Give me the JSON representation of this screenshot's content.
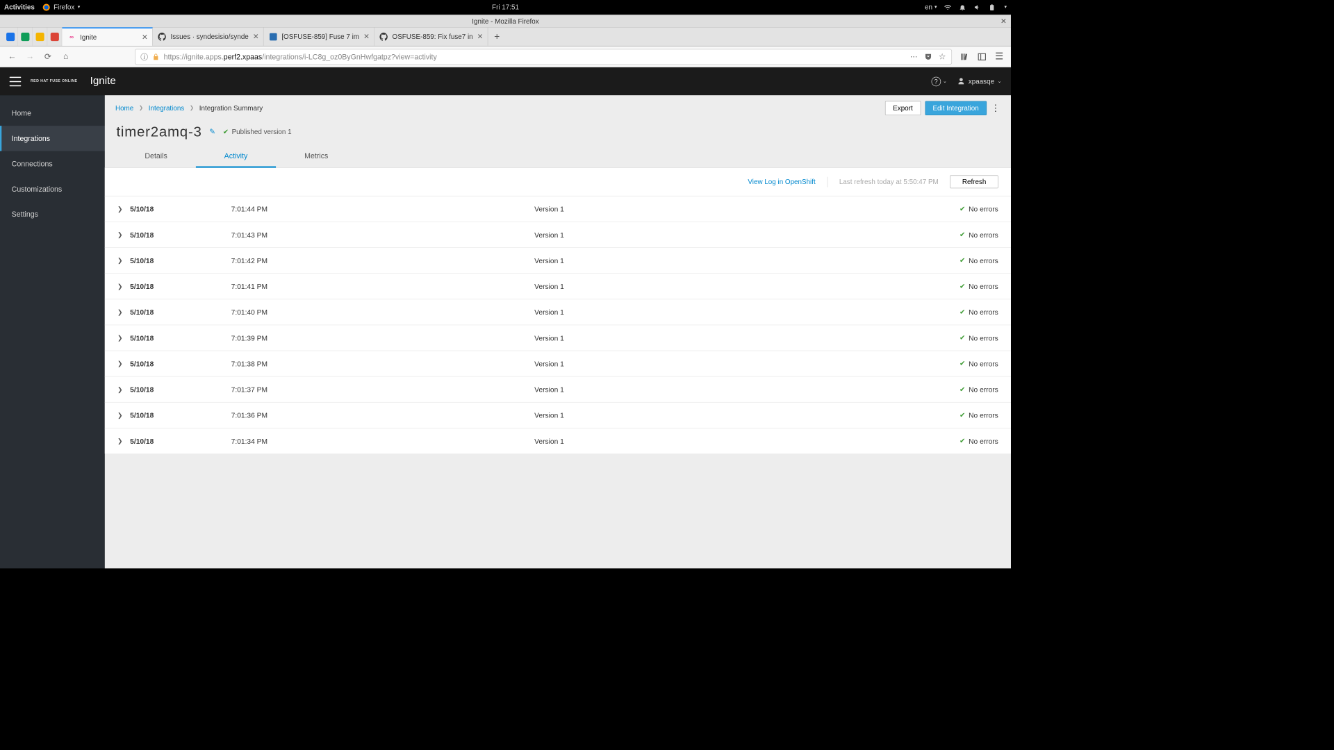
{
  "gnome": {
    "activities": "Activities",
    "app": "Firefox",
    "clock": "Fri 17:51",
    "lang": "en"
  },
  "window_title": "Ignite - Mozilla Firefox",
  "tabs": [
    {
      "label": "Ignite",
      "active": true,
      "icon_color": "#e83e8c"
    },
    {
      "label": "Issues · syndesisio/synde",
      "active": false
    },
    {
      "label": "[OSFUSE-859] Fuse 7 im",
      "active": false
    },
    {
      "label": "OSFUSE-859: Fix fuse7 in",
      "active": false
    }
  ],
  "url": {
    "host_prefix": "https://ignite.apps.",
    "host_bold": "perf2.xpaas",
    "path": "/integrations/i-LC8g_oz0ByGnHwfgatpz?view=activity"
  },
  "app": {
    "brand_small": "RED HAT FUSE ONLINE",
    "brand": "Ignite",
    "user": "xpaasqe"
  },
  "sidebar": {
    "items": [
      {
        "label": "Home"
      },
      {
        "label": "Integrations"
      },
      {
        "label": "Connections"
      },
      {
        "label": "Customizations"
      },
      {
        "label": "Settings"
      }
    ],
    "active": 1
  },
  "breadcrumbs": [
    {
      "label": "Home",
      "link": true
    },
    {
      "label": "Integrations",
      "link": true
    },
    {
      "label": "Integration Summary",
      "link": false
    }
  ],
  "page": {
    "export_label": "Export",
    "edit_label": "Edit Integration",
    "title": "timer2amq-3",
    "published_label": "Published version 1"
  },
  "view_tabs": [
    {
      "label": "Details"
    },
    {
      "label": "Activity"
    },
    {
      "label": "Metrics"
    }
  ],
  "view_active": 1,
  "toolbar": {
    "view_log": "View Log in OpenShift",
    "last_refresh": "Last refresh today at 5:50:47 PM",
    "refresh": "Refresh"
  },
  "activity": [
    {
      "date": "5/10/18",
      "time": "7:01:44 PM",
      "version": "Version 1",
      "errors": "No errors"
    },
    {
      "date": "5/10/18",
      "time": "7:01:43 PM",
      "version": "Version 1",
      "errors": "No errors"
    },
    {
      "date": "5/10/18",
      "time": "7:01:42 PM",
      "version": "Version 1",
      "errors": "No errors"
    },
    {
      "date": "5/10/18",
      "time": "7:01:41 PM",
      "version": "Version 1",
      "errors": "No errors"
    },
    {
      "date": "5/10/18",
      "time": "7:01:40 PM",
      "version": "Version 1",
      "errors": "No errors"
    },
    {
      "date": "5/10/18",
      "time": "7:01:39 PM",
      "version": "Version 1",
      "errors": "No errors"
    },
    {
      "date": "5/10/18",
      "time": "7:01:38 PM",
      "version": "Version 1",
      "errors": "No errors"
    },
    {
      "date": "5/10/18",
      "time": "7:01:37 PM",
      "version": "Version 1",
      "errors": "No errors"
    },
    {
      "date": "5/10/18",
      "time": "7:01:36 PM",
      "version": "Version 1",
      "errors": "No errors"
    },
    {
      "date": "5/10/18",
      "time": "7:01:34 PM",
      "version": "Version 1",
      "errors": "No errors"
    }
  ]
}
